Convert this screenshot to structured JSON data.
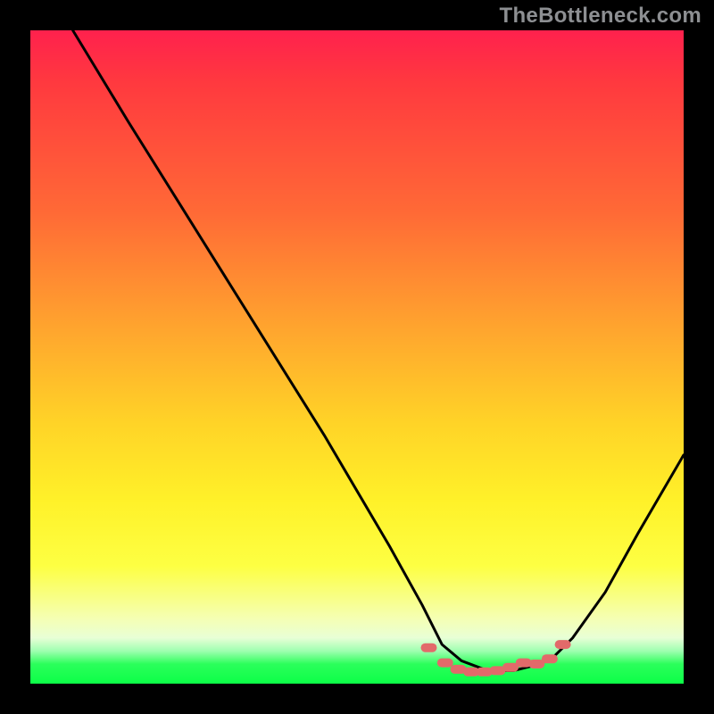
{
  "attribution": "TheBottleneck.com",
  "chart_data": {
    "type": "line",
    "title": "",
    "xlabel": "",
    "ylabel": "",
    "xlim": [
      0,
      1
    ],
    "ylim": [
      0,
      1
    ],
    "note": "Axes are unlabeled. Values estimated as fractions of plot width/height (0 at bottom-left, 1 at top-right). The curve descends from top-left, flattens near the bottom around x≈0.63–0.80, then rises toward the right.",
    "series": [
      {
        "name": "bottleneck-curve",
        "x": [
          0.065,
          0.15,
          0.25,
          0.35,
          0.45,
          0.55,
          0.6,
          0.63,
          0.66,
          0.7,
          0.74,
          0.78,
          0.8,
          0.83,
          0.88,
          0.93,
          1.0
        ],
        "y": [
          1.0,
          0.86,
          0.7,
          0.54,
          0.38,
          0.21,
          0.12,
          0.06,
          0.035,
          0.02,
          0.02,
          0.03,
          0.04,
          0.07,
          0.14,
          0.23,
          0.35
        ]
      }
    ],
    "markers": {
      "name": "highlight-band",
      "x": [
        0.61,
        0.635,
        0.655,
        0.675,
        0.695,
        0.715,
        0.735,
        0.755,
        0.775,
        0.795,
        0.815
      ],
      "y": [
        0.055,
        0.032,
        0.022,
        0.018,
        0.018,
        0.02,
        0.025,
        0.032,
        0.03,
        0.038,
        0.06
      ]
    },
    "background_gradient": {
      "stops": [
        {
          "pos": 0.0,
          "color": "#ff214d"
        },
        {
          "pos": 0.28,
          "color": "#ff6a36"
        },
        {
          "pos": 0.6,
          "color": "#ffd327"
        },
        {
          "pos": 0.82,
          "color": "#fdff43"
        },
        {
          "pos": 0.93,
          "color": "#e8ffd6"
        },
        {
          "pos": 1.0,
          "color": "#0cff47"
        }
      ]
    }
  }
}
